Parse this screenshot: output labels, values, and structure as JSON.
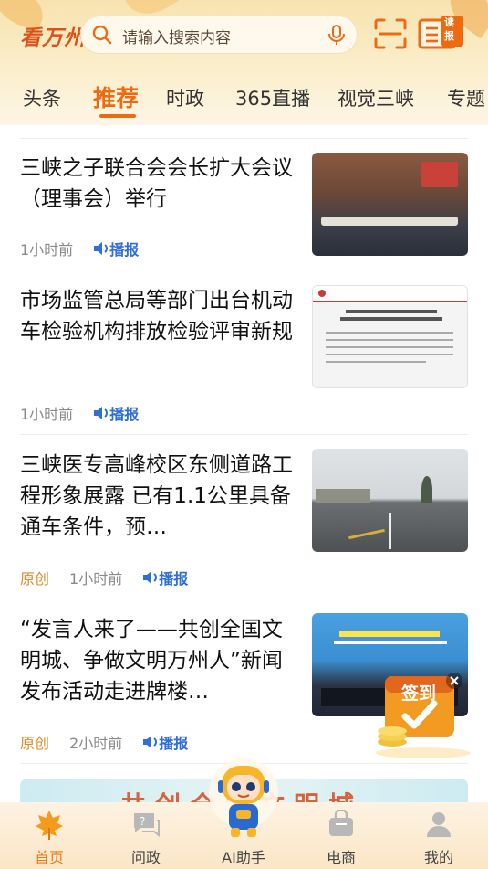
{
  "header": {
    "logo": "看万州",
    "search_placeholder": "请输入搜索内容",
    "read_paper_badge": "读报"
  },
  "tabs": [
    {
      "label": "头条"
    },
    {
      "label": "推荐",
      "active": true
    },
    {
      "label": "时政"
    },
    {
      "label": "365直播"
    },
    {
      "label": "视觉三峡"
    },
    {
      "label": "专题"
    }
  ],
  "articles": [
    {
      "title": "三峡之子联合会会长扩大会议（理事会）举行",
      "time": "1小时前",
      "broadcast": "播报"
    },
    {
      "title": "市场监管总局等部门出台机动车检验机构排放检验评审新规",
      "time": "1小时前",
      "broadcast": "播报"
    },
    {
      "title": "三峡医专高峰校区东侧道路工程形象展露 已有1.1公里具备通车条件，预…",
      "tag": "原创",
      "time": "1小时前",
      "broadcast": "播报"
    },
    {
      "title": "“发言人来了——共创全国文明城、争做文明万州人”新闻发布活动走进牌楼…",
      "tag": "原创",
      "time": "2小时前",
      "broadcast": "播报"
    }
  ],
  "signin_label": "签到",
  "bottom_nav": [
    {
      "label": "首页",
      "icon": "maple-leaf-icon",
      "active": true
    },
    {
      "label": "问政",
      "icon": "question-chat-icon"
    },
    {
      "label": "AI助手",
      "icon": "robot-icon"
    },
    {
      "label": "电商",
      "icon": "shopping-bag-icon"
    },
    {
      "label": "我的",
      "icon": "user-icon"
    }
  ],
  "colors": {
    "accent": "#ee6a11",
    "broadcast": "#2f6fd6",
    "original_tag": "#e08a2a"
  }
}
